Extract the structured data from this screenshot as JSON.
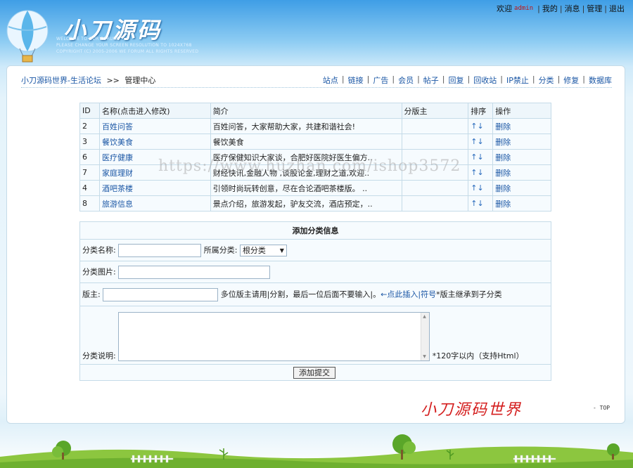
{
  "header": {
    "logo_title": "小刀源码",
    "logo_sub": [
      "WELCOME TO OUR FORUMS",
      "PLEASE CHANGE YOUR SCREEN RESOLUTION TO 1024X768",
      "COPYRIGHT (C) 2005-2006 WE FORUM ALL RIGHTS RESERVED"
    ],
    "welcome": "欢迎",
    "username": "admin",
    "links": [
      "我的",
      "消息",
      "管理",
      "退出"
    ]
  },
  "breadcrumb": {
    "forum": "小刀源码世界-生活论坛",
    "arrow": ">>",
    "current": "管理中心"
  },
  "admin_nav": [
    "站点",
    "链接",
    "广告",
    "会员",
    "帖子",
    "回复",
    "回收站",
    "IP禁止",
    "分类",
    "修复",
    "数据库"
  ],
  "category_table": {
    "headers": [
      "ID",
      "名称(点击进入修改)",
      "简介",
      "分版主",
      "排序",
      "操作"
    ],
    "rows": [
      {
        "id": "2",
        "name": "百姓问答",
        "intro": "百姓问答，大家帮助大家，共建和谐社会!",
        "moderator": "",
        "sort": "↑↓",
        "action": "删除"
      },
      {
        "id": "3",
        "name": "餐饮美食",
        "intro": "餐饮美食",
        "moderator": "",
        "sort": "↑↓",
        "action": "删除"
      },
      {
        "id": "6",
        "name": "医疗健康",
        "intro": "医疗保健知识大家谈，合肥好医院好医生偏方..",
        "moderator": "",
        "sort": "↑↓",
        "action": "删除"
      },
      {
        "id": "7",
        "name": "家庭理财",
        "intro": "财经快讯,金融人物 ,谈股论金,理财之道,欢迎..",
        "moderator": "",
        "sort": "↑↓",
        "action": "删除"
      },
      {
        "id": "4",
        "name": "酒吧茶楼",
        "intro": "引领时尚玩转创意，尽在合论酒吧茶楼版。 ..",
        "moderator": "",
        "sort": "↑↓",
        "action": "删除"
      },
      {
        "id": "8",
        "name": "旅游信息",
        "intro": "景点介绍，旅游发起，驴友交流，酒店预定，..",
        "moderator": "",
        "sort": "↑↓",
        "action": "删除"
      }
    ]
  },
  "add_form": {
    "title": "添加分类信息",
    "name_label": "分类名称:",
    "name_value": "",
    "parent_label": "所属分类:",
    "parent_selected": "根分类",
    "image_label": "分类图片:",
    "image_value": "",
    "moderator_label": "版主:",
    "moderator_value": "",
    "moderator_hint": "多位版主请用|分割，最后一位后面不要输入|。",
    "insert_link": "←点此插入|符号",
    "inherit_note": "*版主继承到子分类",
    "desc_label": "分类说明:",
    "desc_value": "",
    "desc_hint": "*120字以内（支持Html）",
    "submit_label": "添加提交"
  },
  "watermark": "https://www.huzhan.com/ishop3572",
  "footer": {
    "brand": "小刀源码世界",
    "top_link": "- TOP"
  },
  "colors": {
    "link": "#1b57a5",
    "border": "#c5dbe8",
    "brand_red": "#d41e1e"
  }
}
